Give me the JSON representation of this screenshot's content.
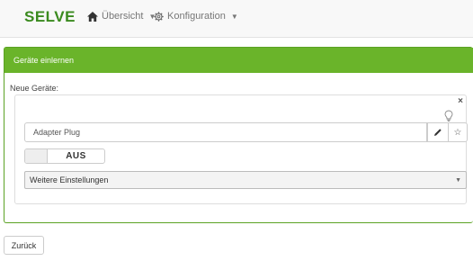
{
  "navbar": {
    "brand": "SELVE",
    "items": [
      {
        "label": "Übersicht",
        "icon": "home-icon"
      },
      {
        "label": "Konfiguration",
        "icon": "gear-icon"
      }
    ]
  },
  "panel": {
    "title": "Geräte einlernen",
    "new_devices_label": "Neue Geräte:",
    "device": {
      "name_value": "Adapter Plug",
      "toggle_label": "AUS",
      "settings_select": "Weitere Einstellungen"
    }
  },
  "footer": {
    "back_label": "Zurück"
  },
  "colors": {
    "brand": "#3a8a1e",
    "panel_header": "#6ab42a"
  }
}
